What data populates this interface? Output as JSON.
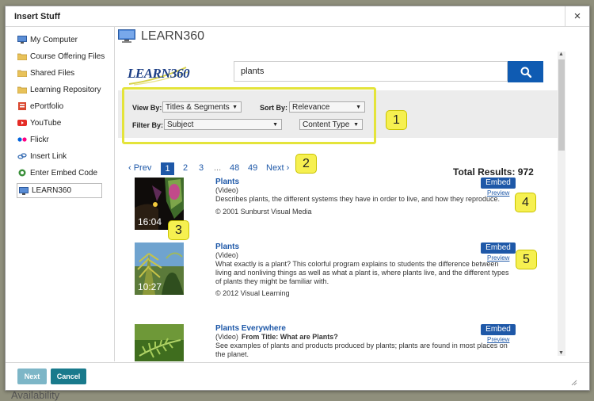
{
  "background": {
    "bottom_text": "Availability"
  },
  "dialog": {
    "title": "Insert Stuff",
    "close_glyph": "×"
  },
  "sidebar": {
    "items": [
      {
        "label": "My Computer",
        "icon": "computer-icon"
      },
      {
        "label": "Course Offering Files",
        "icon": "folder-icon"
      },
      {
        "label": "Shared Files",
        "icon": "folder-icon"
      },
      {
        "label": "Learning Repository",
        "icon": "folder-icon"
      },
      {
        "label": "ePortfolio",
        "icon": "eportfolio-icon"
      },
      {
        "label": "YouTube",
        "icon": "youtube-icon"
      },
      {
        "label": "Flickr",
        "icon": "flickr-icon"
      },
      {
        "label": "Insert Link",
        "icon": "link-icon"
      },
      {
        "label": "Enter Embed Code",
        "icon": "embed-code-icon"
      },
      {
        "label": "LEARN360",
        "icon": "monitor-icon",
        "selected": true
      }
    ]
  },
  "main": {
    "title": "LEARN360",
    "logo_text": "LEARN360",
    "search": {
      "value": "plants"
    },
    "filters": {
      "view_by_label": "View By:",
      "view_by_value": "Titles & Segments",
      "sort_by_label": "Sort By:",
      "sort_by_value": "Relevance",
      "filter_by_label": "Filter By:",
      "filter_by_value": "Subject",
      "content_type_value": "Content Type"
    },
    "pager": {
      "prev": "‹ Prev",
      "pages": [
        "1",
        "2",
        "3",
        "...",
        "48",
        "49"
      ],
      "current": "1",
      "next": "Next ›"
    },
    "total_results": "Total Results: 972",
    "results": [
      {
        "title": "Plants",
        "type": "(Video)",
        "from_title": "",
        "description": "Describes plants, the different systems they have in order to live, and how they reproduce.",
        "copyright": "© 2001  Sunburst Visual Media",
        "duration": "16:04",
        "embed_label": "Embed",
        "preview_label": "Preview"
      },
      {
        "title": "Plants",
        "type": "(Video)",
        "from_title": "",
        "description": "What exactly is a plant? This colorful program explains to students the difference between living and nonliving things as well as what a plant is, where plants live, and the different types of plants they might be familiar with.",
        "copyright": "© 2012  Visual Learning",
        "duration": "10:27",
        "embed_label": "Embed",
        "preview_label": "Preview"
      },
      {
        "title": "Plants Everywhere",
        "type": "(Video)",
        "from_title": "From Title: What are Plants?",
        "description": "See examples of plants and products produced by plants; plants are found in most places on the planet.",
        "copyright": "",
        "duration": "",
        "embed_label": "Embed",
        "preview_label": "Preview"
      }
    ]
  },
  "callouts": [
    "1",
    "2",
    "3",
    "4",
    "5"
  ],
  "footer": {
    "next_label": "Next",
    "cancel_label": "Cancel"
  },
  "colors": {
    "accent_blue": "#1e58a8",
    "search_button": "#0f5bb2",
    "highlight_yellow": "#e4e43a",
    "callout_fill": "#f6f050",
    "cancel_button": "#197a8c",
    "next_button": "#7db6c7"
  }
}
